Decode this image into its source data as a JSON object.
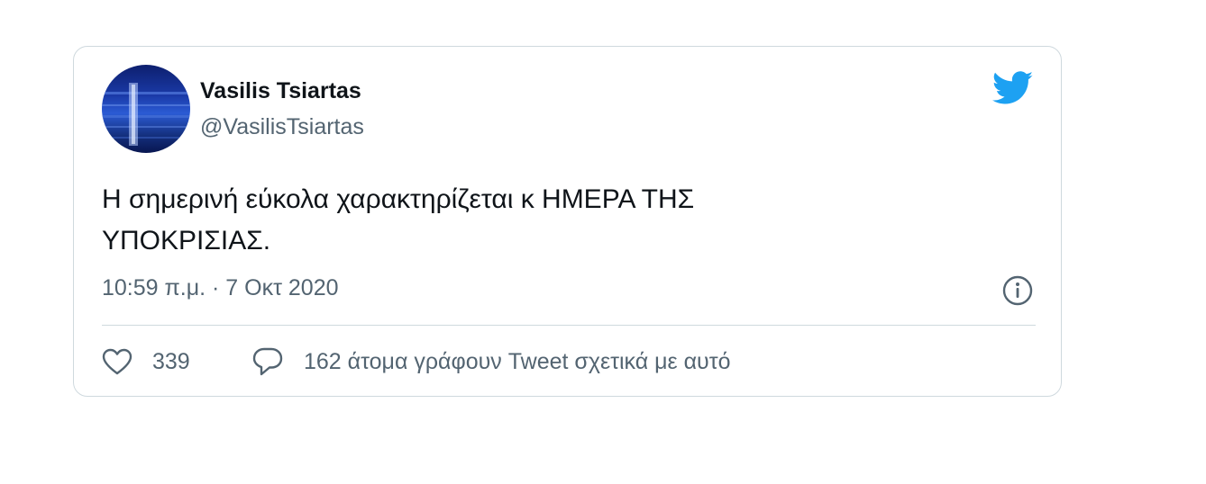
{
  "author": {
    "name": "Vasilis Tsiartas",
    "handle": "@VasilisTsiartas"
  },
  "tweet": {
    "text_line1": "Η σημερινή εύκολα χαρακτηρίζεται κ ΗΜΕΡΑ ΤΗΣ",
    "text_line2": "ΥΠΟΚΡΙΣΙΑΣ.",
    "timestamp": "10:59 π.μ. · 7 Οκτ 2020"
  },
  "actions": {
    "likes": "339",
    "replies_label": "162 άτομα γράφουν Tweet σχετικά με αυτό"
  },
  "icons": {
    "brand": "twitter-bird-icon",
    "info": "info-icon",
    "like": "heart-icon",
    "reply": "speech-bubble-icon"
  },
  "colors": {
    "brand": "#1da1f2",
    "text": "#0f1419",
    "secondary": "#536471",
    "border": "#cfd9de"
  }
}
